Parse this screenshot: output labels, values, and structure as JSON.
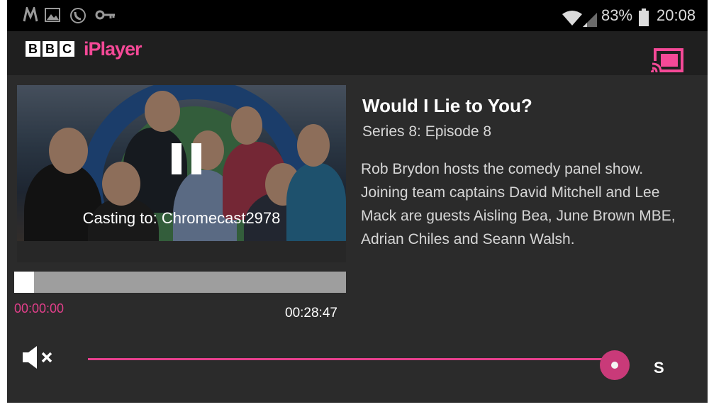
{
  "status_bar": {
    "battery_percent": "83%",
    "time": "20:08",
    "icons": [
      "m-notification-icon",
      "image-icon",
      "phone-icon",
      "key-icon",
      "wifi-icon",
      "signal-icon",
      "battery-icon"
    ]
  },
  "app_bar": {
    "brand_bbc_letters": [
      "B",
      "B",
      "C"
    ],
    "brand_product": "iPlayer",
    "cast_icon": "cast-connected-icon"
  },
  "player": {
    "casting_text": "Casting to: Chromecast2978",
    "elapsed": "00:00:00",
    "total": "00:28:47",
    "progress_fraction": 0.06,
    "state": "playing",
    "pause_icon": "pause-icon"
  },
  "episode": {
    "title": "Would I Lie to You?",
    "subtitle": "Series 8: Episode 8",
    "description": "Rob Brydon hosts the comedy panel show. Joining team captains David Mitchell and Lee Mack are guests Aisling Bea, June Brown MBE, Adrian Chiles and Seann Walsh."
  },
  "controls": {
    "mute_icon": "volume-mute-icon",
    "volume_fraction": 1.0,
    "end_label": "S"
  },
  "colors": {
    "accent": "#e6408d",
    "background": "#2b2b2b",
    "status_bar": "#000000"
  }
}
